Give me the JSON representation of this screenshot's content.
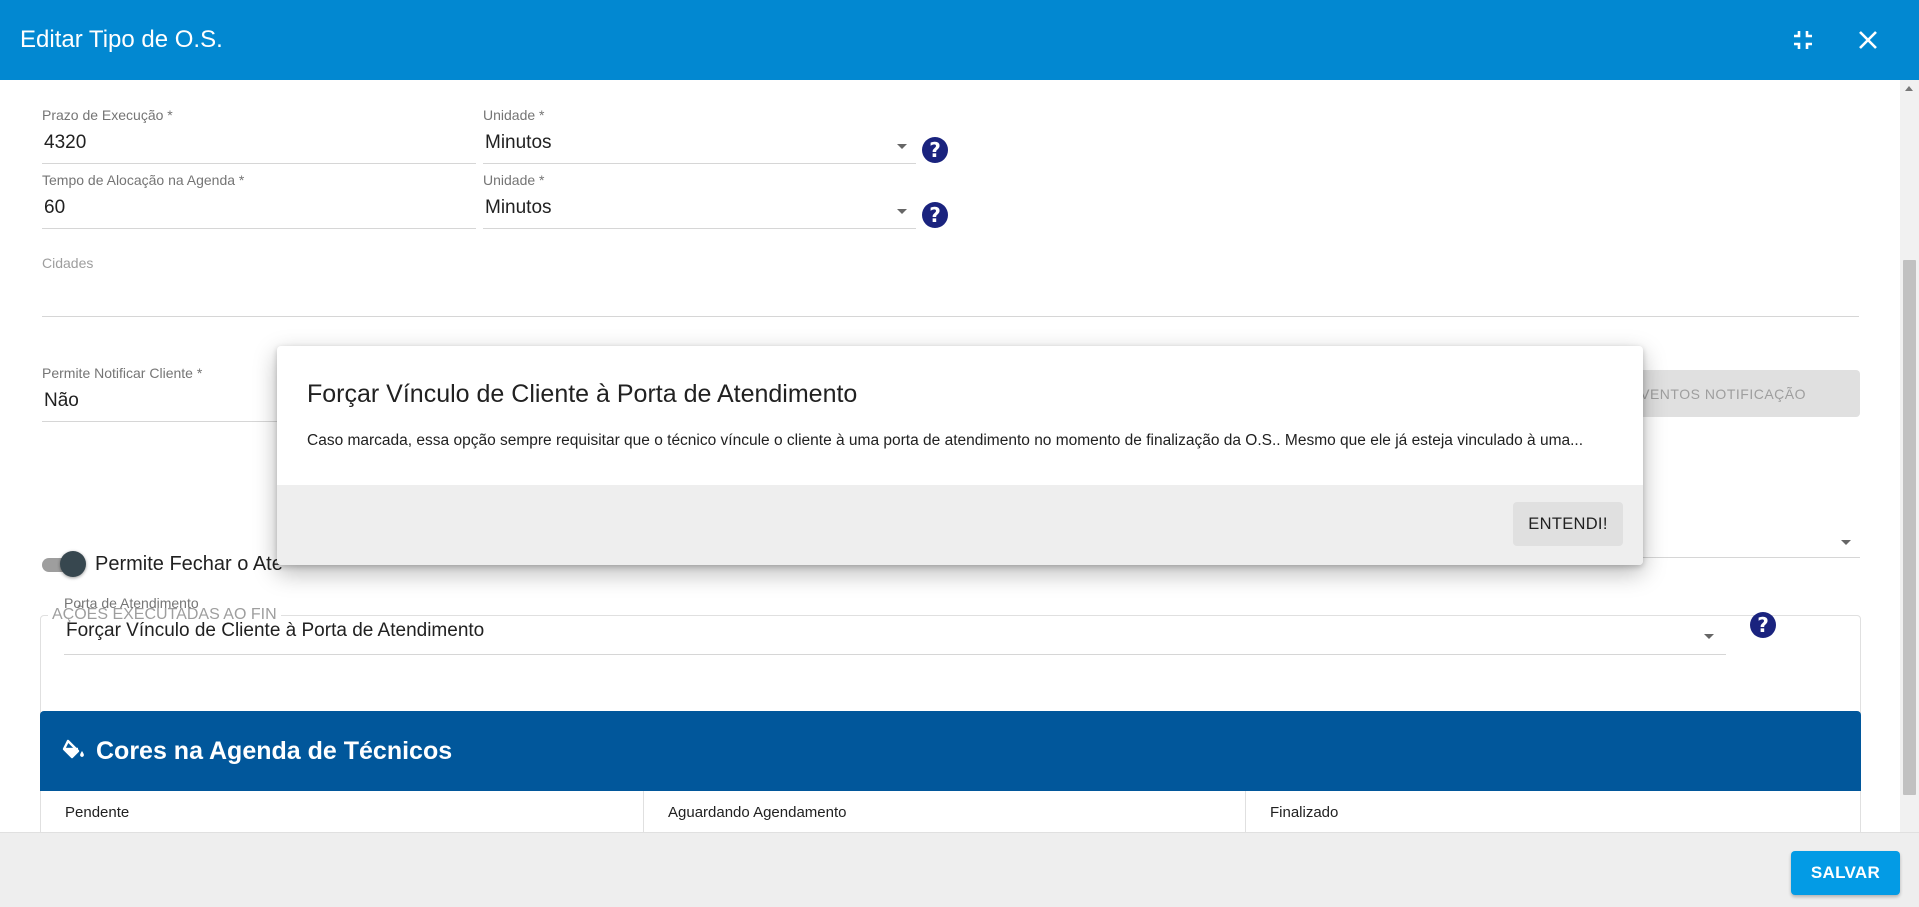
{
  "header": {
    "title": "Editar Tipo de O.S."
  },
  "form": {
    "prazo": {
      "label": "Prazo de Execução *",
      "value": "4320"
    },
    "prazo_unidade": {
      "label": "Unidade *",
      "value": "Minutos"
    },
    "tempo": {
      "label": "Tempo de Alocação na Agenda *",
      "value": "60"
    },
    "tempo_unidade": {
      "label": "Unidade *",
      "value": "Minutos"
    },
    "cidades": {
      "label": "Cidades",
      "value": ""
    },
    "notificar": {
      "label": "Permite Notificar Cliente *",
      "value": "Não"
    },
    "eventos_button": "EVENTOS NOTIFICAÇÃO",
    "toggle_label": "Permite Fechar o Ate",
    "acoes_legend": "AÇÕES EXECUTADAS AO FIN",
    "porta": {
      "label": "Porta de Atendimento",
      "value": "Forçar Vínculo de Cliente à Porta de Atendimento"
    }
  },
  "cores": {
    "title": "Cores na Agenda de Técnicos",
    "columns": [
      "Pendente",
      "Aguardando Agendamento",
      "Finalizado"
    ]
  },
  "footer": {
    "save_label": "SALVAR"
  },
  "modal": {
    "title": "Forçar Vínculo de Cliente à Porta de Atendimento",
    "text": "Caso marcada, essa opção sempre requisitar que o técnico víncule o cliente à uma porta de atendimento no momento de finalização da O.S.. Mesmo que ele já esteja vinculado à uma...",
    "ok_label": "ENTENDI!"
  },
  "colors": {
    "header": "#0288d1",
    "cores_header": "#01579b",
    "save_button": "#039be5",
    "help_icon": "#1a237e"
  },
  "icons": {
    "compress": "compress-icon",
    "close": "close-icon",
    "help": "help-icon",
    "paint": "paint-bucket-icon"
  }
}
